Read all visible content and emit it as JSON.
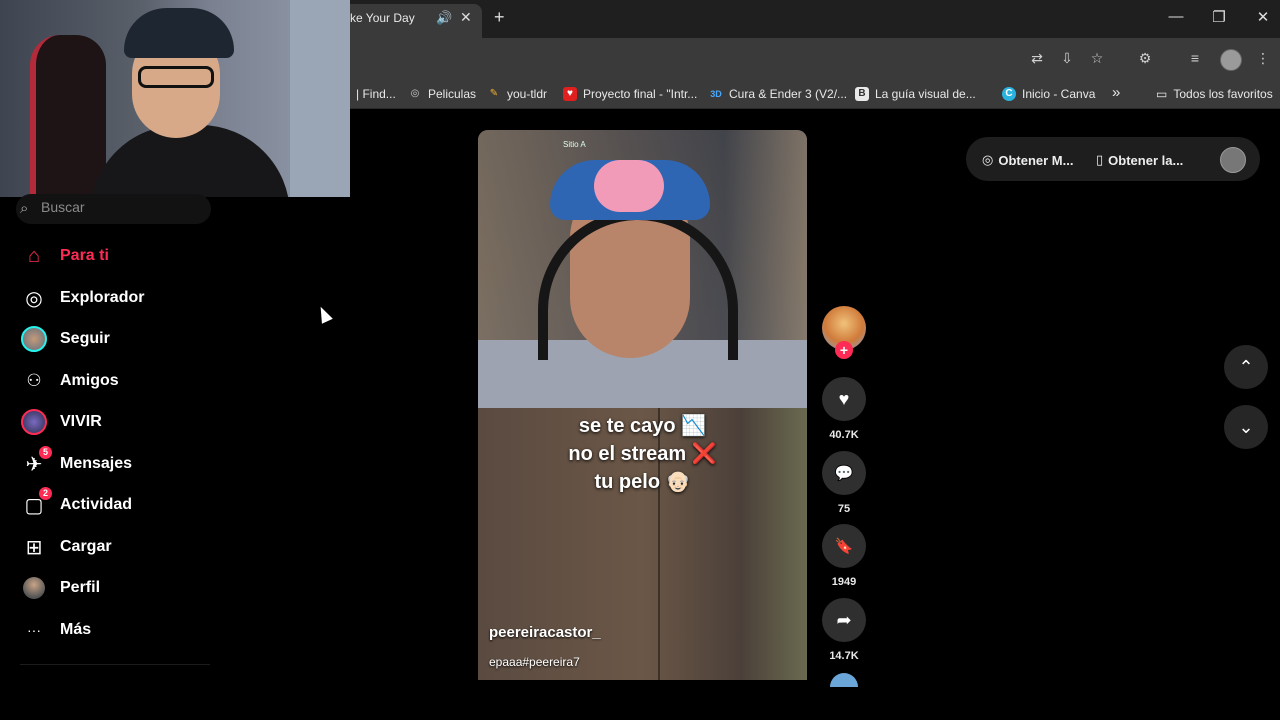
{
  "browser": {
    "tab_title": "ke Your Day",
    "audio_icon": "🔊",
    "close_icon": "✕",
    "new_tab_icon": "+",
    "window_controls": {
      "minimize": "—",
      "restore": "❐",
      "close": "✕"
    },
    "toolbar_icons": {
      "translate": "⇄",
      "install": "⇩",
      "star": "☆",
      "extensions": "⚙",
      "media": "≡",
      "menu": "⋮"
    },
    "bookmarks": [
      {
        "label": "| Find...",
        "icon": ""
      },
      {
        "label": "Peliculas",
        "icon": "◎"
      },
      {
        "label": "you-tldr",
        "icon": "✎"
      },
      {
        "label": "Proyecto final - \"Intr...",
        "icon": "♥"
      },
      {
        "label": "Cura & Ender 3 (V2/...",
        "icon": "3D"
      },
      {
        "label": "La guía visual de...",
        "icon": "B"
      },
      {
        "label": "Inicio - Canva",
        "icon": "C"
      }
    ],
    "bookmarks_more": "»",
    "all_bookmarks_label": "Todos los favoritos",
    "all_bookmarks_icon": "▭"
  },
  "sidebar": {
    "search_placeholder": "Buscar",
    "search_icon": "⌕",
    "items": [
      {
        "label": "Para ti",
        "icon": "⌂",
        "active": true
      },
      {
        "label": "Explorador",
        "icon": "◎"
      },
      {
        "label": "Seguir",
        "icon": "avatar"
      },
      {
        "label": "Amigos",
        "icon": "👥"
      },
      {
        "label": "VIVIR",
        "icon": "avatar"
      },
      {
        "label": "Mensajes",
        "icon": "✈",
        "badge": "5"
      },
      {
        "label": "Actividad",
        "icon": "▢",
        "badge": "2"
      },
      {
        "label": "Cargar",
        "icon": "⊞"
      },
      {
        "label": "Perfil",
        "icon": "avatar"
      },
      {
        "label": "Más",
        "icon": "···"
      }
    ]
  },
  "video": {
    "hud_label": "Sitio A",
    "caption_lines": [
      "se te cayo 📉",
      "no el stream ❌",
      "tu pelo 👴🏻"
    ],
    "author": "peereiracastor_",
    "description": "epaaa#peereira7"
  },
  "actions": {
    "follow_icon": "+",
    "like_icon": "♥",
    "like_count": "40.7K",
    "comment_icon": "💬",
    "comment_count": "75",
    "save_icon": "🔖",
    "save_count": "1949",
    "share_icon": "➦",
    "share_count": "14.7K"
  },
  "top_right": {
    "get_app_label": "Obtener M...",
    "get_app_icon": "◎",
    "get_mobile_label": "Obtener la...",
    "get_mobile_icon": "▯"
  },
  "nav_buttons": {
    "up_icon": "⌃",
    "down_icon": "⌄"
  },
  "colors": {
    "accent": "#fe2c55",
    "background": "#000000",
    "chrome": "#3a3a3a"
  }
}
